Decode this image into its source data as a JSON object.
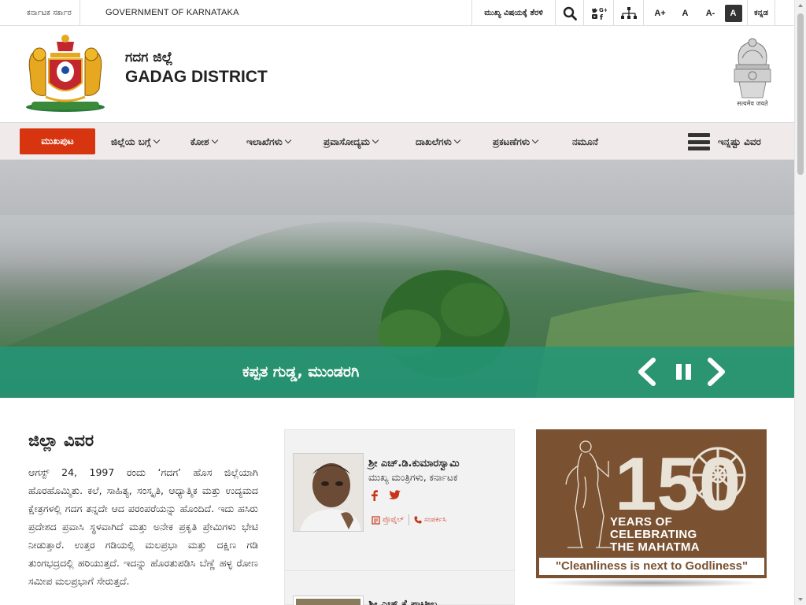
{
  "topbar": {
    "gov_kannada": "ಕರ್ನಾಟಕ ಸರ್ಕಾರ",
    "gov_english": "GOVERNMENT OF KARNATAKA",
    "skip_to_main": "ಮುಖ್ಯ ವಿಷಯಕ್ಕೆ ತೆರಳಿ",
    "font_increase": "A+",
    "font_normal": "A",
    "font_decrease": "A-",
    "contrast": "A",
    "language": "ಕನ್ನಡ"
  },
  "header": {
    "title_kannada": "ಗದಗ ಜಿಲ್ಲೆ",
    "title_english": "GADAG DISTRICT",
    "emblem_caption": "सत्यमेव जयते"
  },
  "nav": {
    "home": "ಮುಖಪುಟ",
    "items": [
      {
        "label": "ಜಿಲ್ಲೆಯ ಬಗ್ಗೆ",
        "dropdown": true
      },
      {
        "label": "ಕೋಶ",
        "dropdown": true
      },
      {
        "label": "ಇಲಾಖೆಗಳು",
        "dropdown": true
      },
      {
        "label": "ಪ್ರವಾಸೋದ್ಯಮ",
        "dropdown": true
      },
      {
        "label": "ದಾಖಲೆಗಳು",
        "dropdown": true
      },
      {
        "label": "ಪ್ರಕಟಣೆಗಳು",
        "dropdown": true
      },
      {
        "label": "ನಮೂನೆ",
        "dropdown": false
      }
    ],
    "more": "ಇನ್ನಷ್ಟು ವಿವರ"
  },
  "hero": {
    "caption": "ಕಪ್ಪತ ಗುಡ್ಡ, ಮುಂಡರಗಿ"
  },
  "about": {
    "title": "ಜಿಲ್ಲಾ ವಿವರ",
    "text": "ಆಗಸ್ಟ್ 24, 1997 ರಂದು ‘ಗದಗ’ ಹೊಸ ಜಿಲ್ಲೆಯಾಗಿ ಹೊರಹೊಮ್ಮಿತು. ಕಲೆ, ಸಾಹಿತ್ಯ, ಸಂಸ್ಕೃತಿ, ಆಧ್ಯಾತ್ಮಿಕ ಮತ್ತು ಉದ್ಯಮದ ಕ್ಷೇತ್ರಗಳಲ್ಲಿ ಗದಗ ತನ್ನದೇ ಆದ ಪರಂಪರೆಯನ್ನು ಹೊಂದಿದೆ. ಇದು ಹಸಿರು ಪ್ರದೇಶದ ಪ್ರವಾಸಿ ಸ್ಥಳವಾಗಿದೆ ಮತ್ತು ಅನೇಕ ಪ್ರಕೃತಿ ಪ್ರೇಮಿಗಳು ಭೇಟಿ ನೀಡುತ್ತಾರೆ. ಉತ್ತರ ಗಡಿಯಲ್ಲಿ ಮಲಪ್ರಭಾ ಮತ್ತು ದಕ್ಷಿಣ ಗಡಿ ತುಂಗಭದ್ರದಲ್ಲಿ ಹರಿಯುತ್ತದೆ. ಇದನ್ನು ಹೊರತುಪಡಿಸಿ ಬೆಣ್ಣೆ ಹಳ್ಳ ರೋಣ ಸಮೀಪ ಮಲಪ್ರಭಾಗೆ ಸೇರುತ್ತದೆ."
  },
  "ministers": [
    {
      "name": "ಶ್ರೀ ಎಚ್.ಡಿ.ಕುಮಾರಸ್ವಾಮಿ",
      "role": "ಮುಖ್ಯ ಮಂತ್ರಿಗಳು, ಕರ್ನಾಟಕ",
      "profile_label": "ಪ್ರೊಫೈಲ್",
      "contact_label": "ಸಂಪರ್ಕಿಸಿ"
    },
    {
      "name": "ಶ್ರೀ ಎಚ್.ಕೆ.ಪಾಟೀಲ"
    }
  ],
  "banner": {
    "years_line1": "YEARS OF",
    "years_line2": "CELEBRATING",
    "years_line3": "THE MAHATMA",
    "quote": "\"Cleanliness is next to Godliness\"",
    "number": "150"
  },
  "colors": {
    "home_button": "#d6350f",
    "nav_bg": "#f1eaea",
    "caption_bar": "#229678",
    "banner_bg": "#7a5232",
    "link_red": "#c8341a"
  }
}
